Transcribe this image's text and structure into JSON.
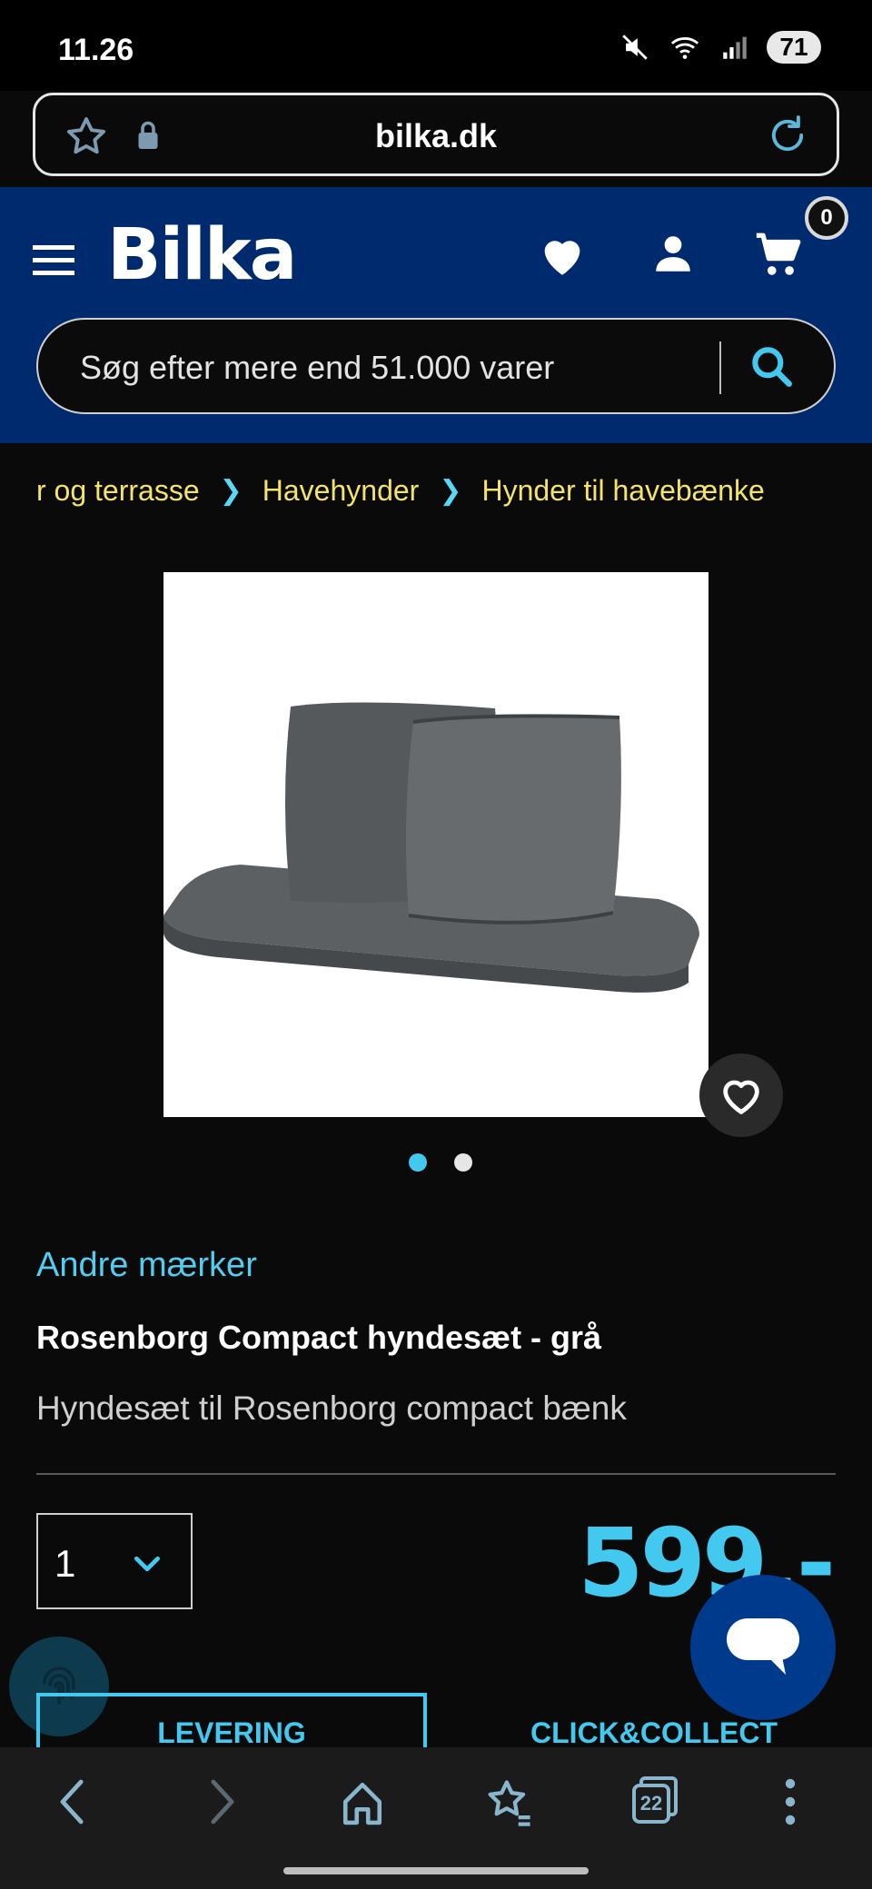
{
  "status_bar": {
    "time": "11.26",
    "battery": "71"
  },
  "browser": {
    "url": "bilka.dk",
    "tab_count": "22"
  },
  "header": {
    "logo": "Bilka",
    "cart_count": "0",
    "search_placeholder": "Søg efter mere end 51.000 varer",
    "brand_color": "#002a6e"
  },
  "breadcrumb": {
    "items": [
      "r og terrasse",
      "Havehynder",
      "Hynder til havebænke"
    ]
  },
  "product": {
    "brand": "Andre mærker",
    "title": "Rosenborg Compact hyndesæt - grå",
    "subtitle": "Hyndesæt til Rosenborg compact bænk",
    "quantity": "1",
    "price": "599,-",
    "image_count": 2,
    "active_image": 1
  },
  "purchase_tabs": {
    "delivery": "LEVERING",
    "click_collect": "CLICK&COLLECT"
  },
  "colors": {
    "accent": "#43c8ef",
    "breadcrumb": "#f3e36c",
    "background": "#0a0a0a"
  }
}
